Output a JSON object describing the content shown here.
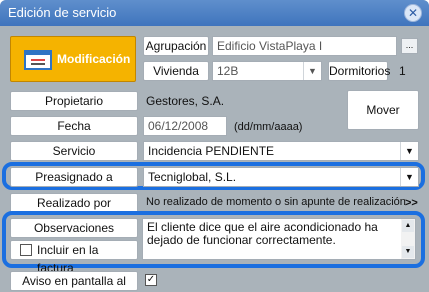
{
  "window": {
    "title": "Edición de servicio"
  },
  "header": {
    "mode_button_label": "Modificación",
    "agrupacion_label": "Agrupación",
    "agrupacion_value": "Edificio VistaPlaya I",
    "vivienda_label": "Vivienda",
    "vivienda_value": "12B",
    "dormitorios_label": "Dormitorios",
    "dormitorios_value": "1",
    "dots_label": "..."
  },
  "form": {
    "propietario_label": "Propietario",
    "propietario_value": "Gestores, S.A.",
    "fecha_label": "Fecha",
    "fecha_value": "06/12/2008",
    "fecha_format": "(dd/mm/aaaa)",
    "mover_label": "Mover",
    "servicio_label": "Servicio",
    "servicio_value": "Incidencia PENDIENTE",
    "preasignado_label": "Preasignado a",
    "preasignado_value": "Tecniglobal, S.L.",
    "realizado_label": "Realizado por",
    "realizado_value": "No realizado de momento o sin apunte de realización",
    "realizado_more": ">>",
    "observaciones_label": "Observaciones",
    "observaciones_value": "El cliente dice que el aire acondicionado ha dejado de funcionar correctamente.",
    "incluir_label": "Incluir en la factura",
    "aviso_label": "Aviso en pantalla al inicio",
    "aviso_checked": "✓"
  },
  "colors": {
    "accent": "#f5b300",
    "titlebar": "#4a7fc4",
    "highlight": "#1b6fe0",
    "background": "#aab3ba"
  }
}
